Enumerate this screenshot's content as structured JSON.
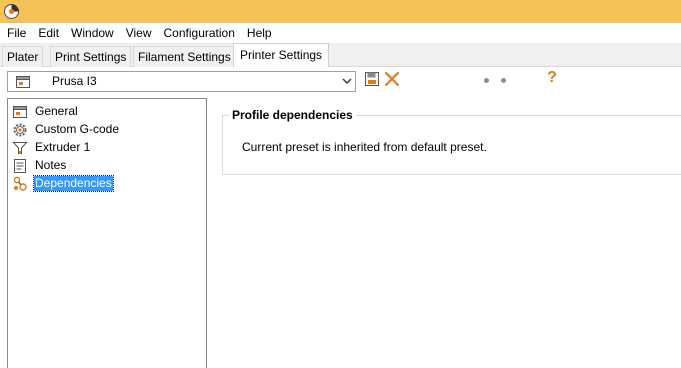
{
  "menu": {
    "items": [
      {
        "label": "File"
      },
      {
        "label": "Edit"
      },
      {
        "label": "Window"
      },
      {
        "label": "View"
      },
      {
        "label": "Configuration"
      },
      {
        "label": "Help"
      }
    ]
  },
  "tabs": [
    {
      "label": "Plater"
    },
    {
      "label": "Print Settings"
    },
    {
      "label": "Filament Settings"
    },
    {
      "label": "Printer Settings",
      "active": true
    }
  ],
  "preset": {
    "selected": "Prusa I3",
    "icon": "printer-preset-icon"
  },
  "toolbar": {
    "save_icon": "save-icon",
    "delete_icon": "delete-icon",
    "help_label": "?"
  },
  "tree": {
    "items": [
      {
        "label": "General",
        "icon": "printer-icon"
      },
      {
        "label": "Custom G-code",
        "icon": "gear-icon"
      },
      {
        "label": "Extruder 1",
        "icon": "funnel-icon"
      },
      {
        "label": "Notes",
        "icon": "note-icon"
      },
      {
        "label": "Dependencies",
        "icon": "dependencies-icon",
        "selected": true
      }
    ]
  },
  "dependencies": {
    "title": "Profile dependencies",
    "text": "Current preset is inherited from default preset."
  },
  "colors": {
    "titlebar": "#f5c25a",
    "accent": "#e07a1f",
    "selection": "#3399ff"
  }
}
